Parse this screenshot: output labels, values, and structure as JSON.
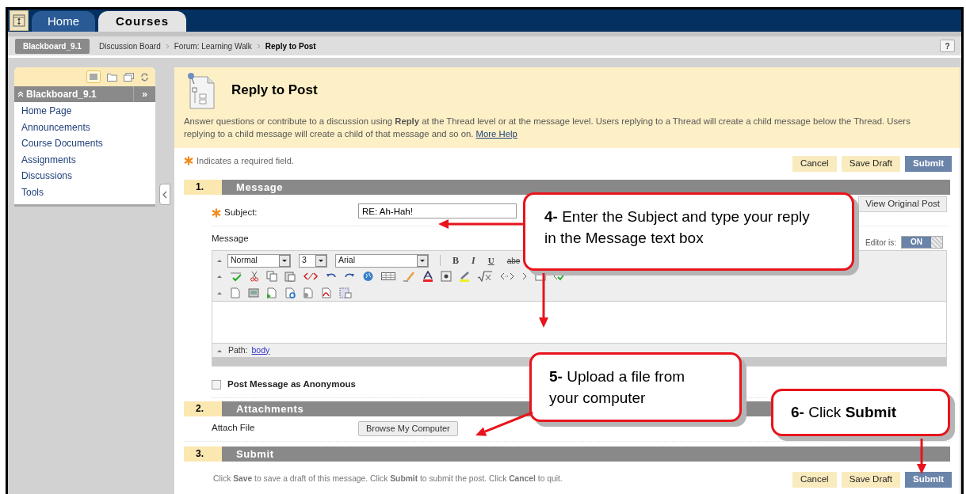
{
  "nav": {
    "tabs": [
      {
        "label": "Home",
        "selected": false
      },
      {
        "label": "Courses",
        "selected": true
      }
    ]
  },
  "breadcrumb": {
    "course": "Blackboard_9.1",
    "items": [
      {
        "label": "Discussion Board",
        "current": false
      },
      {
        "label": "Forum: Learning Walk",
        "current": false
      },
      {
        "label": "Reply to Post",
        "current": true
      }
    ],
    "help": "?"
  },
  "course_menu": {
    "title": "Blackboard_9.1",
    "expand": "»",
    "items": [
      "Home Page",
      "Announcements",
      "Course Documents",
      "Assignments",
      "Discussions",
      "Tools"
    ]
  },
  "page_header": {
    "title": "Reply to Post",
    "description": "Answer questions or contribute to a discussion using **Reply** at the Thread level or at the message level. Users replying to a Thread will create a child message below the Thread. Users replying to a child message will create a child of that message and so on.",
    "help_link": "More Help"
  },
  "required_note": "Indicates a required field.",
  "top_buttons": [
    {
      "label": "Cancel",
      "kind": "secondary"
    },
    {
      "label": "Save Draft",
      "kind": "secondary"
    },
    {
      "label": "Submit",
      "kind": "primary"
    }
  ],
  "sections": [
    {
      "number": "1.",
      "title": "Message",
      "kind": "message",
      "subject_label": "Subject:",
      "subject_value": "RE: Ah-Hah!",
      "view_original": "View Original Post",
      "message_label": "Message",
      "editor_toggle": {
        "label": "Editor is:",
        "text": "ON",
        "on": true
      },
      "selects": [
        "Normal",
        "3",
        "Arial"
      ],
      "format_buttons": [
        {
          "text": "B",
          "kind": "bold"
        },
        {
          "text": "I",
          "kind": "italic"
        },
        {
          "text": "U",
          "kind": "underline"
        },
        {
          "text": "abe",
          "kind": "strike"
        }
      ],
      "path_label": "Path:",
      "path_link": "body",
      "anonymous": {
        "label": "Post Message as Anonymous",
        "checked": false
      }
    },
    {
      "number": "2.",
      "title": "Attachments",
      "kind": "attachments",
      "label": "Attach File",
      "button": "Browse My Computer"
    },
    {
      "number": "3.",
      "title": "Submit",
      "kind": "submit",
      "instructions": "Click **Save** to save a draft of this message. Click **Submit** to submit the post. Click **Cancel** to quit.",
      "buttons": [
        {
          "label": "Cancel",
          "kind": "secondary"
        },
        {
          "label": "Save Draft",
          "kind": "secondary"
        },
        {
          "label": "Submit",
          "kind": "primary"
        }
      ]
    }
  ],
  "callouts": [
    {
      "text": "**4-** Enter the Subject and type your reply in the Message text box"
    },
    {
      "text": "**5-** Upload a file from your computer"
    },
    {
      "text": "**6-** Click **Submit**"
    }
  ]
}
